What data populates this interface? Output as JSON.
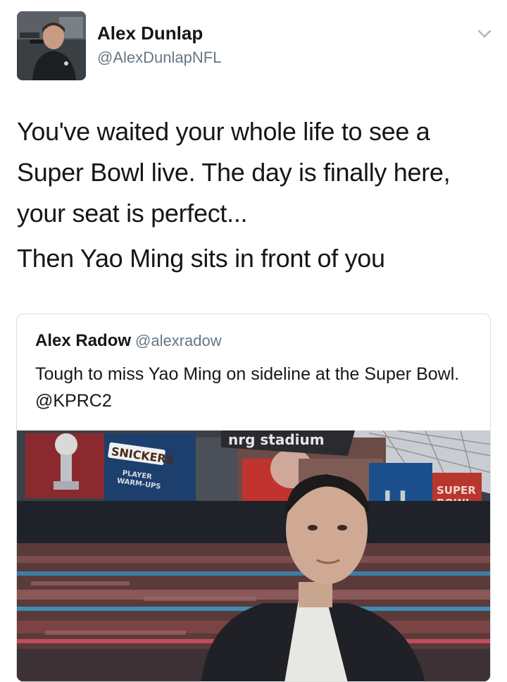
{
  "author": {
    "name": "Alex Dunlap",
    "handle": "@AlexDunlapNFL"
  },
  "tweet": {
    "text_line_1": "You've waited your whole life to see a Super Bowl live. The day is finally here, your seat is perfect...",
    "text_line_2": "Then Yao Ming sits in front of you"
  },
  "quoted_tweet": {
    "name": "Alex Radow",
    "handle": "@alexradow",
    "text": "Tough to miss Yao Ming on sideline at the Super Bowl. @KPRC2",
    "image": {
      "stadium_sign": "nrg stadium",
      "sponsor_board": "SNICKERS",
      "board_caption_1": "PLAYER",
      "board_caption_2": "WARM-UPS",
      "logo_numeral": "LI",
      "logo_text_1": "SUPER",
      "logo_text_2": "BOWL"
    }
  },
  "icons": {
    "caret": "chevron-down-icon"
  },
  "colors": {
    "text_primary": "#14171a",
    "text_secondary": "#657786",
    "border": "#d8dee3"
  }
}
